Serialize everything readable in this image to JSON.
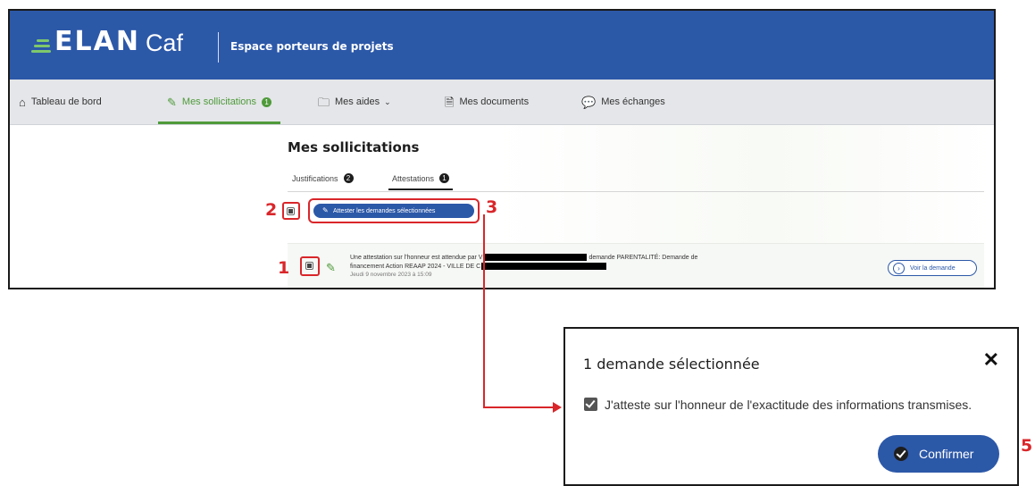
{
  "header": {
    "logo_elan": "ELAN",
    "logo_caf": "Caf",
    "app_title": "Espace porteurs de projets",
    "brand_color": "#2c58a8",
    "accent_color": "#4f9a3a"
  },
  "nav": {
    "items": [
      {
        "label": "Tableau de bord",
        "icon": "home-icon"
      },
      {
        "label": "Mes sollicitations",
        "icon": "pencil-icon",
        "badge": "1",
        "active": true
      },
      {
        "label": "Mes aides",
        "icon": "folder-icon",
        "dropdown": true
      },
      {
        "label": "Mes documents",
        "icon": "document-icon"
      },
      {
        "label": "Mes échanges",
        "icon": "chat-icon"
      }
    ]
  },
  "main": {
    "title": "Mes sollicitations",
    "tabs": [
      {
        "label": "Justifications",
        "count": "2"
      },
      {
        "label": "Attestations",
        "count": "1",
        "active": true
      }
    ],
    "attest_button": "Attester les demandes sélectionnées",
    "request": {
      "text_part1": "Une attestation sur l'honneur est attendue par V",
      "text_part2": "demande PARENTALITÉ: Demande de",
      "text_line2": "financement Action REAAP 2024 - VILLE DE C",
      "date": "Jeudi 9 novembre 2023 à 15:09",
      "view_button": "Voir la demande"
    }
  },
  "annotations": {
    "step1": "1",
    "step2": "2",
    "step3": "3",
    "step5": "5",
    "color": "#d9262a"
  },
  "modal": {
    "title": "1 demande sélectionnée",
    "close": "✕",
    "checkbox_label": "J'atteste sur l'honneur de l'exactitude des informations transmises.",
    "checkbox_checked": true,
    "confirm_button": "Confirmer"
  }
}
